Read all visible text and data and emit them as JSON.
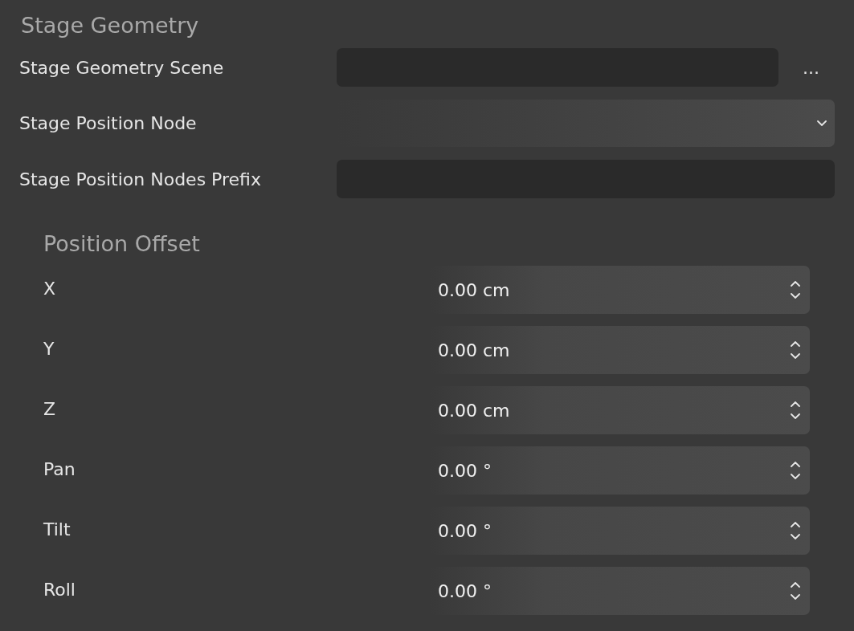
{
  "section": {
    "title": "Stage Geometry",
    "fields": [
      {
        "kind": "file",
        "label": "Stage Geometry Scene",
        "browse": "..."
      },
      {
        "kind": "dropdown",
        "label": "Stage Position Node"
      },
      {
        "kind": "text",
        "label": "Stage Position Nodes Prefix"
      }
    ]
  },
  "position_offset": {
    "title": "Position Offset",
    "rows": [
      {
        "label": "X",
        "value": "0.00 cm"
      },
      {
        "label": "Y",
        "value": "0.00 cm"
      },
      {
        "label": "Z",
        "value": "0.00 cm"
      },
      {
        "label": "Pan",
        "value": "0.00 °"
      },
      {
        "label": "Tilt",
        "value": "0.00 °"
      },
      {
        "label": "Roll",
        "value": "0.00 °"
      }
    ]
  }
}
